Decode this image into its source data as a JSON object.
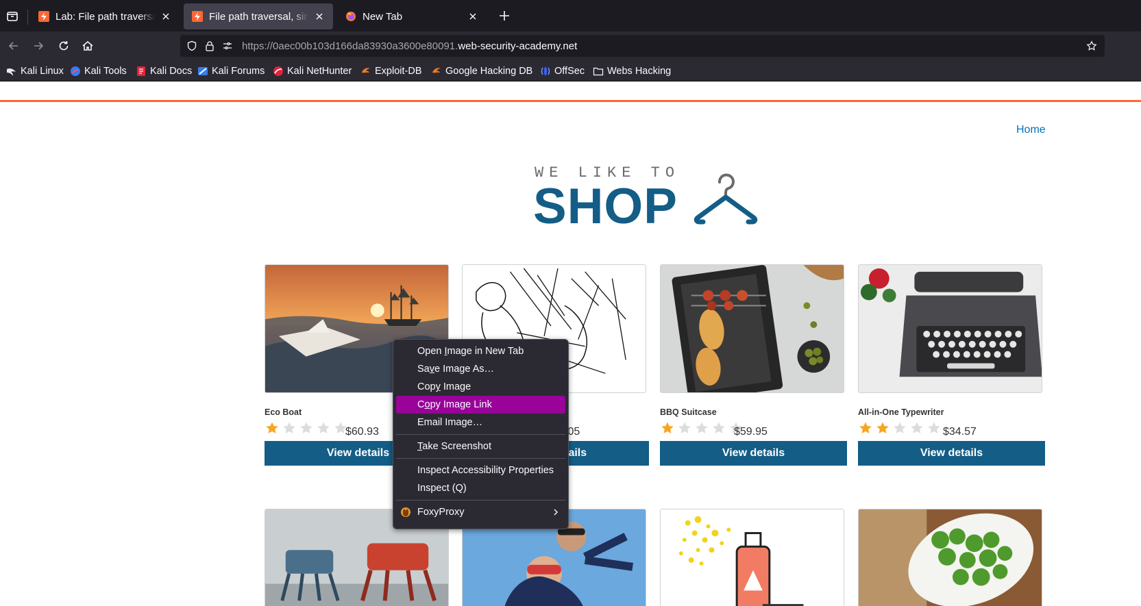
{
  "browser": {
    "tabs": [
      {
        "label": "Lab: File path traversal, simple case",
        "active": false,
        "favicon": "portswigger-icon"
      },
      {
        "label": "File path traversal, simple case",
        "active": true,
        "favicon": "portswigger-icon"
      },
      {
        "label": "New Tab",
        "active": false,
        "favicon": "firefox-icon"
      }
    ],
    "url_prefix": "https://0aec00b103d166da83930a3600e80091.",
    "url_domain": "web-security-academy.net",
    "bookmarks": [
      {
        "label": "Kali Linux",
        "icon": "kali-dragon-icon"
      },
      {
        "label": "Kali Tools",
        "icon": "kali-tools-icon"
      },
      {
        "label": "Kali Docs",
        "icon": "kali-docs-icon"
      },
      {
        "label": "Kali Forums",
        "icon": "kali-forums-icon"
      },
      {
        "label": "Kali NetHunter",
        "icon": "nethunter-icon"
      },
      {
        "label": "Exploit-DB",
        "icon": "exploit-db-icon"
      },
      {
        "label": "Google Hacking DB",
        "icon": "ghdb-icon"
      },
      {
        "label": "OffSec",
        "icon": "offsec-icon"
      },
      {
        "label": "Webs Hacking",
        "icon": "folder-icon"
      }
    ]
  },
  "page": {
    "home_link": "Home",
    "logo_tagline": "WE LIKE TO",
    "logo_title": "SHOP",
    "view_details_label": "View details",
    "products": [
      {
        "name": "Eco Boat",
        "rating": 1,
        "price": "$60.93"
      },
      {
        "name": "",
        "rating": 0,
        "price": ".05"
      },
      {
        "name": "BBQ Suitcase",
        "rating": 1,
        "price": "$59.95"
      },
      {
        "name": "All-in-One Typewriter",
        "rating": 2,
        "price": "$34.57"
      }
    ],
    "colors": {
      "brand": "#135d86",
      "accent": "#ff6633",
      "star": "#f5a623",
      "link": "#0071bc"
    }
  },
  "context_menu": {
    "items": [
      {
        "pre": "Open ",
        "u": "I",
        "post": "mage in New Tab"
      },
      {
        "pre": "Sa",
        "u": "v",
        "post": "e Image As…"
      },
      {
        "pre": "Cop",
        "u": "y",
        "post": " Image"
      },
      {
        "pre": "C",
        "u": "o",
        "post": "py Image Link",
        "highlight": true
      },
      {
        "pre": "",
        "u": "",
        "post": "Email Image…"
      },
      {
        "sep": true
      },
      {
        "pre": "",
        "u": "T",
        "post": "ake Screenshot"
      },
      {
        "sep": true
      },
      {
        "pre": "",
        "u": "",
        "post": "Inspect Accessibility Properties"
      },
      {
        "pre": "",
        "u": "",
        "post": "Inspect (Q)"
      },
      {
        "sep": true
      },
      {
        "pre": "",
        "u": "",
        "post": "FoxyProxy",
        "icon": "foxyproxy-icon",
        "submenu": true
      }
    ]
  }
}
